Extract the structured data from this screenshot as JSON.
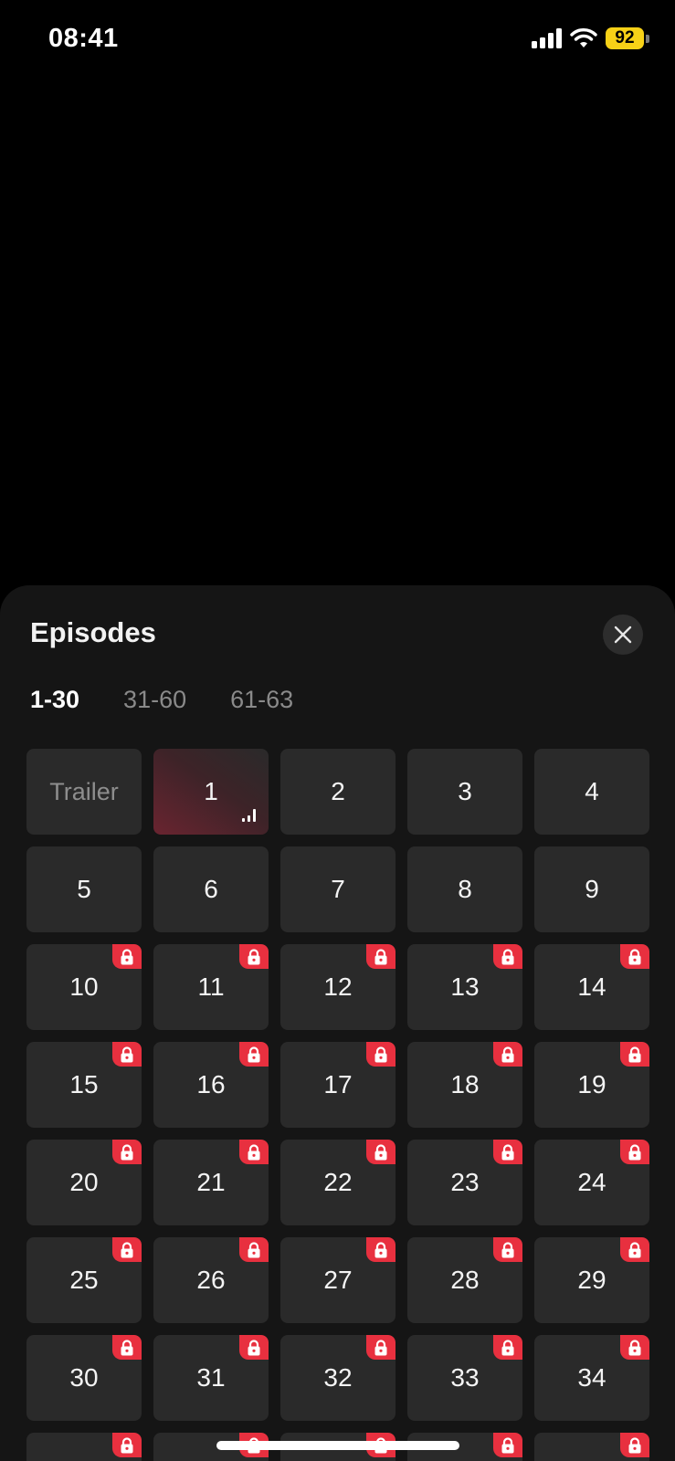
{
  "status_bar": {
    "time": "08:41",
    "battery_level": "92",
    "battery_color": "#f7d117",
    "signal_icon": "cellular-signal-icon",
    "wifi_icon": "wifi-icon"
  },
  "sheet": {
    "title": "Episodes",
    "close_icon": "close-icon",
    "tabs": [
      {
        "label": "1-30",
        "active": true
      },
      {
        "label": "31-60",
        "active": false
      },
      {
        "label": "61-63",
        "active": false
      }
    ],
    "episodes": [
      {
        "label": "Trailer",
        "type": "trailer",
        "locked": false
      },
      {
        "label": "1",
        "type": "episode",
        "locked": false,
        "playing": true
      },
      {
        "label": "2",
        "type": "episode",
        "locked": false
      },
      {
        "label": "3",
        "type": "episode",
        "locked": false
      },
      {
        "label": "4",
        "type": "episode",
        "locked": false
      },
      {
        "label": "5",
        "type": "episode",
        "locked": false
      },
      {
        "label": "6",
        "type": "episode",
        "locked": false
      },
      {
        "label": "7",
        "type": "episode",
        "locked": false
      },
      {
        "label": "8",
        "type": "episode",
        "locked": false
      },
      {
        "label": "9",
        "type": "episode",
        "locked": false
      },
      {
        "label": "10",
        "type": "episode",
        "locked": true
      },
      {
        "label": "11",
        "type": "episode",
        "locked": true
      },
      {
        "label": "12",
        "type": "episode",
        "locked": true
      },
      {
        "label": "13",
        "type": "episode",
        "locked": true
      },
      {
        "label": "14",
        "type": "episode",
        "locked": true
      },
      {
        "label": "15",
        "type": "episode",
        "locked": true
      },
      {
        "label": "16",
        "type": "episode",
        "locked": true
      },
      {
        "label": "17",
        "type": "episode",
        "locked": true
      },
      {
        "label": "18",
        "type": "episode",
        "locked": true
      },
      {
        "label": "19",
        "type": "episode",
        "locked": true
      },
      {
        "label": "20",
        "type": "episode",
        "locked": true
      },
      {
        "label": "21",
        "type": "episode",
        "locked": true
      },
      {
        "label": "22",
        "type": "episode",
        "locked": true
      },
      {
        "label": "23",
        "type": "episode",
        "locked": true
      },
      {
        "label": "24",
        "type": "episode",
        "locked": true
      },
      {
        "label": "25",
        "type": "episode",
        "locked": true
      },
      {
        "label": "26",
        "type": "episode",
        "locked": true
      },
      {
        "label": "27",
        "type": "episode",
        "locked": true
      },
      {
        "label": "28",
        "type": "episode",
        "locked": true
      },
      {
        "label": "29",
        "type": "episode",
        "locked": true
      },
      {
        "label": "30",
        "type": "episode",
        "locked": true
      },
      {
        "label": "31",
        "type": "episode",
        "locked": true
      },
      {
        "label": "32",
        "type": "episode",
        "locked": true
      },
      {
        "label": "33",
        "type": "episode",
        "locked": true
      },
      {
        "label": "34",
        "type": "episode",
        "locked": true
      },
      {
        "label": "",
        "type": "episode",
        "locked": true
      },
      {
        "label": "",
        "type": "episode",
        "locked": true
      },
      {
        "label": "",
        "type": "episode",
        "locked": true
      },
      {
        "label": "",
        "type": "episode",
        "locked": true
      },
      {
        "label": "",
        "type": "episode",
        "locked": true
      }
    ],
    "lock_icon": "lock-icon",
    "lock_color": "#e8303f",
    "playing_icon": "now-playing-icon"
  }
}
